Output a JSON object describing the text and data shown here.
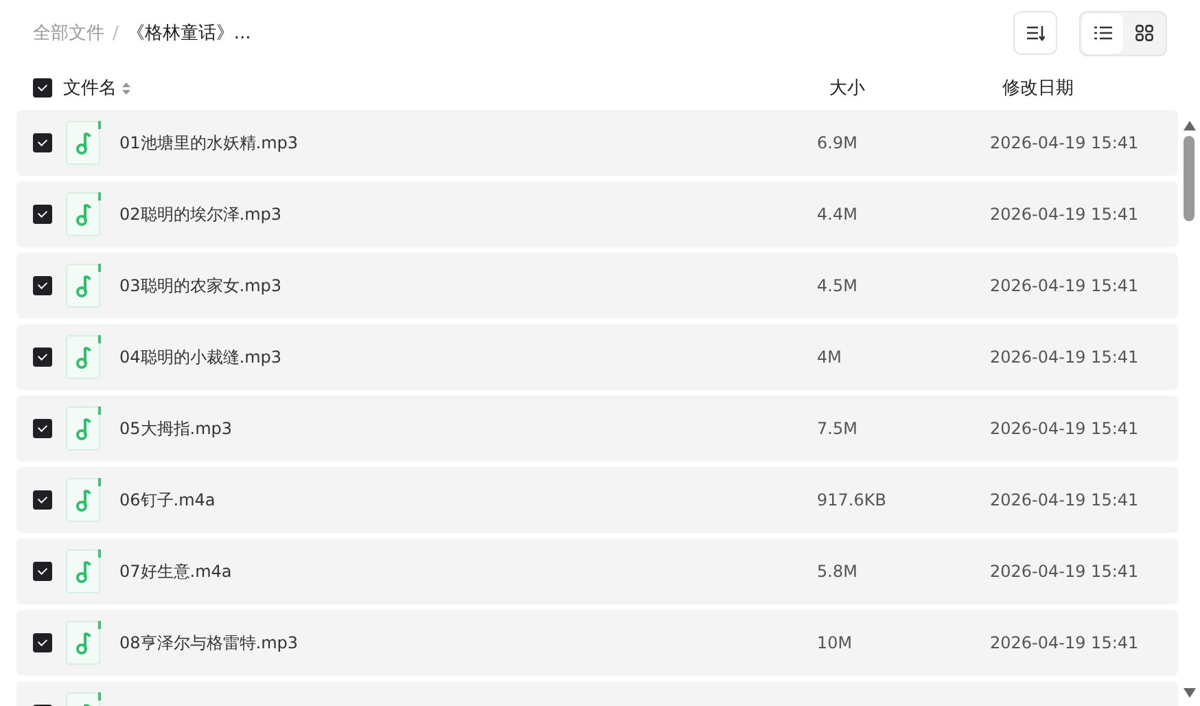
{
  "breadcrumb": [
    {
      "label": "全部文件"
    },
    {
      "label": "/"
    },
    {
      "label": "《格林童话》..."
    }
  ],
  "view_modes": [
    {
      "kind": "list",
      "selected": true
    },
    {
      "kind": "grid",
      "selected": false
    }
  ],
  "table": {
    "select_all": {
      "checked": true
    },
    "columns": [
      "文件名",
      "大小",
      "修改日期"
    ],
    "rows": [
      {
        "checked": true,
        "name": "01池塘里的水妖精.mp3",
        "size": "6.9M",
        "modified": "2026-04-19 15:41"
      },
      {
        "checked": true,
        "name": "02聪明的埃尔泽.mp3",
        "size": "4.4M",
        "modified": "2026-04-19 15:41"
      },
      {
        "checked": true,
        "name": "03聪明的农家女.mp3",
        "size": "4.5M",
        "modified": "2026-04-19 15:41"
      },
      {
        "checked": true,
        "name": "04聪明的小裁缝.mp3",
        "size": "4M",
        "modified": "2026-04-19 15:41"
      },
      {
        "checked": true,
        "name": "05大拇指.mp3",
        "size": "7.5M",
        "modified": "2026-04-19 15:41"
      },
      {
        "checked": true,
        "name": "06钉子.m4a",
        "size": "917.6KB",
        "modified": "2026-04-19 15:41"
      },
      {
        "checked": true,
        "name": "07好生意.m4a",
        "size": "5.8M",
        "modified": "2026-04-19 15:41"
      },
      {
        "checked": true,
        "name": "08亨泽尔与格雷特.mp3",
        "size": "10M",
        "modified": "2026-04-19 15:41"
      },
      {
        "checked": true
      }
    ]
  }
}
